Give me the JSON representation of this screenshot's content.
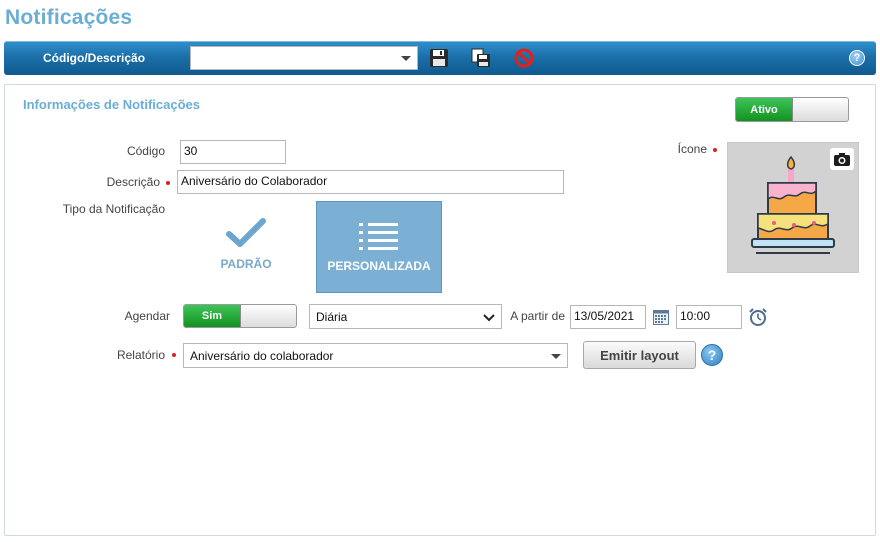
{
  "page": {
    "title": "Notificações"
  },
  "toolbar": {
    "code_label": "Código/Descrição",
    "code_value": "",
    "help": "?"
  },
  "section": {
    "title": "Informações de Notificações"
  },
  "status_toggle": {
    "label": "Ativo",
    "on": true
  },
  "form": {
    "codigo_label": "Código",
    "codigo_value": "30",
    "descricao_label": "Descrição",
    "descricao_value": "Aniversário do Colaborador",
    "tipo_label": "Tipo da Notificação",
    "icone_label": "Ícone",
    "agendar_label": "Agendar",
    "agendar_toggle": "Sim",
    "frequency_value": "Diária",
    "a_partir_label": "A partir de",
    "date_value": "13/05/2021",
    "time_value": "10:00",
    "relatorio_label": "Relatório",
    "relatorio_value": "Aniversário do colaborador",
    "emit_button": "Emitir layout",
    "help": "?"
  },
  "types": [
    {
      "label": "PADRÃO",
      "selected": false
    },
    {
      "label": "PERSONALIZADA",
      "selected": true
    }
  ],
  "colors": {
    "title": "#6aaed6",
    "toolbar": "#1c6fa9",
    "toggle_on": "#14921f",
    "selected_card": "#7bafd4",
    "required": "#e02020"
  }
}
